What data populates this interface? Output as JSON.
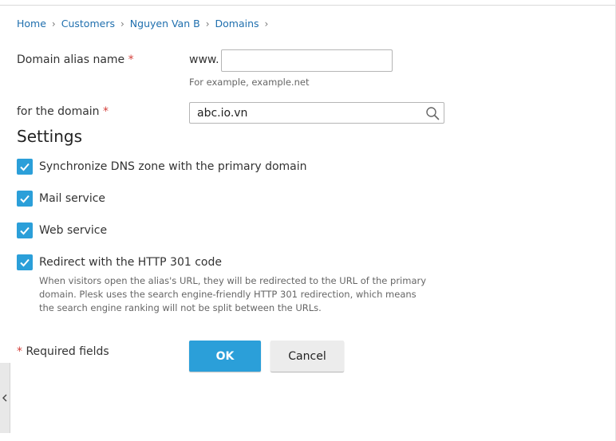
{
  "breadcrumb": {
    "items": [
      "Home",
      "Customers",
      "Nguyen Van B",
      "Domains"
    ],
    "separator": "›"
  },
  "form": {
    "alias_label": "Domain alias name",
    "required_mark": "*",
    "alias_prefix": "www.",
    "alias_value": "",
    "alias_hint": "For example, example.net",
    "domain_label": "for the domain",
    "domain_value": "abc.io.vn"
  },
  "settings": {
    "title": "Settings",
    "options": [
      {
        "label": "Synchronize DNS zone with the primary domain",
        "checked": true
      },
      {
        "label": "Mail service",
        "checked": true
      },
      {
        "label": "Web service",
        "checked": true
      },
      {
        "label": "Redirect with the HTTP 301 code",
        "checked": true
      }
    ],
    "redirect_description": "When visitors open the alias's URL, they will be redirected to the URL of the primary domain. Plesk uses the search engine-friendly HTTP 301 redirection, which means the search engine ranking will not be split between the URLs."
  },
  "footer": {
    "required_note": "Required fields",
    "ok_label": "OK",
    "cancel_label": "Cancel"
  },
  "colors": {
    "accent": "#2b9fd9",
    "link": "#1f6fae",
    "required": "#d43f3a"
  },
  "icons": {
    "search": "search-icon",
    "checkmark": "check-icon",
    "collapse": "chevron-left-icon"
  }
}
